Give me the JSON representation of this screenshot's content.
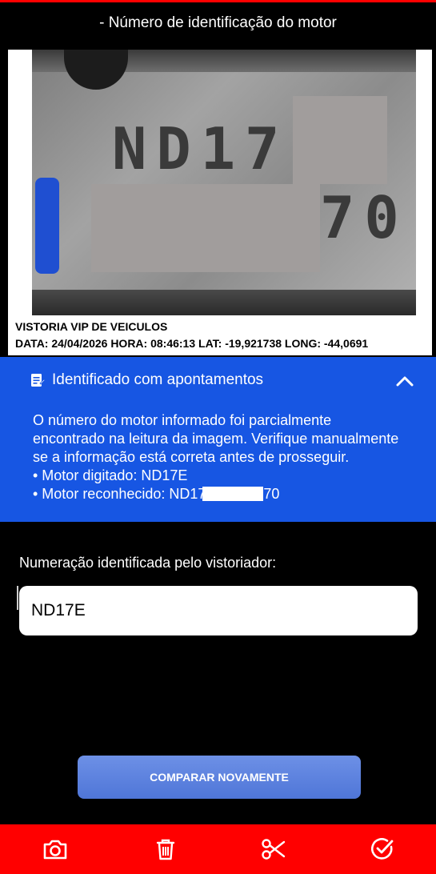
{
  "header": {
    "title": "- Número de identificação do motor"
  },
  "photo": {
    "engraved_text_line1": "ND17",
    "engraved_text_line2": "70",
    "caption_line1": "VISTORIA VIP DE VEICULOS",
    "caption_line2": "DATA: 24/04/2026  HORA: 08:46:13  LAT: -19,921738  LONG: -44,0691"
  },
  "alert": {
    "icon": "note-edit-icon",
    "title": "Identificado com apontamentos",
    "toggle_icon": "chevron-up-icon",
    "message": "O número do motor informado foi parcialmente encontrado na leitura da imagem. Verifique manualmente se a informação está correta antes de prosseguir.",
    "bullet_typed": "• Motor digitado: ND17E",
    "bullet_recognized_prefix": "• Motor reconhecido: ND17",
    "bullet_recognized_suffix": "70",
    "background": "#1756e3"
  },
  "form": {
    "label": "Numeração identificada pelo vistoriador:",
    "value": "ND17E"
  },
  "actions": {
    "compare_label": "COMPARAR NOVAMENTE"
  },
  "bottom_bar": {
    "background": "#ff0000",
    "icons": [
      "camera-icon",
      "trash-icon",
      "scissors-icon",
      "check-circle-icon"
    ]
  }
}
